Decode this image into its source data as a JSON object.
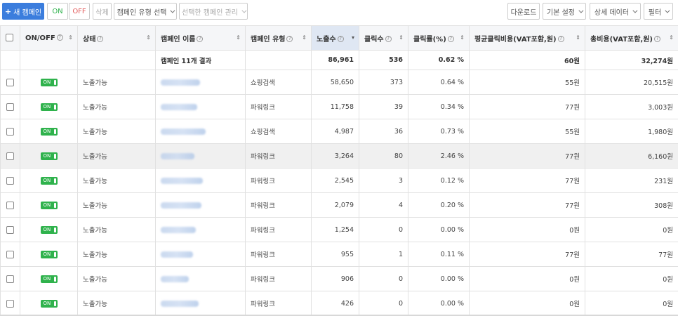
{
  "toolbar": {
    "new_campaign": "새 캠페인",
    "on": "ON",
    "off": "OFF",
    "delete": "삭제",
    "campaign_type_select": "캠페인 유형 선택",
    "manage_selected": "선택한 캠페인 관리",
    "download": "다운로드",
    "basic_settings": "기본 설정",
    "detail_data": "상세 데이터",
    "filter": "필터"
  },
  "table": {
    "headers": {
      "onoff": "ON/OFF",
      "status": "상태",
      "name": "캠페인 이름",
      "type": "캠페인 유형",
      "impressions": "노출수",
      "clicks": "클릭수",
      "ctr": "클릭률(%)",
      "avg_cpc": "평균클릭비용(VAT포함,원)",
      "total_cost": "총비용(VAT포함,원)"
    },
    "help_glyph": "?",
    "sort_glyph": "⇕",
    "sort_active_glyph": "▾",
    "summary": {
      "label": "캠페인 11개 결과",
      "impressions": "86,961",
      "clicks": "536",
      "ctr": "0.62 %",
      "avg_cpc": "60원",
      "total_cost": "32,274원"
    },
    "toggle_label": "ON",
    "rows": [
      {
        "status": "노출가능",
        "type": "쇼핑검색",
        "impressions": "58,650",
        "clicks": "373",
        "ctr": "0.64 %",
        "avg_cpc": "55원",
        "total_cost": "20,515원"
      },
      {
        "status": "노출가능",
        "type": "파워링크",
        "impressions": "11,758",
        "clicks": "39",
        "ctr": "0.34 %",
        "avg_cpc": "77원",
        "total_cost": "3,003원"
      },
      {
        "status": "노출가능",
        "type": "쇼핑검색",
        "impressions": "4,987",
        "clicks": "36",
        "ctr": "0.73 %",
        "avg_cpc": "55원",
        "total_cost": "1,980원"
      },
      {
        "status": "노출가능",
        "type": "파워링크",
        "impressions": "3,264",
        "clicks": "80",
        "ctr": "2.46 %",
        "avg_cpc": "77원",
        "total_cost": "6,160원"
      },
      {
        "status": "노출가능",
        "type": "파워링크",
        "impressions": "2,545",
        "clicks": "3",
        "ctr": "0.12 %",
        "avg_cpc": "77원",
        "total_cost": "231원"
      },
      {
        "status": "노출가능",
        "type": "파워링크",
        "impressions": "2,079",
        "clicks": "4",
        "ctr": "0.20 %",
        "avg_cpc": "77원",
        "total_cost": "308원"
      },
      {
        "status": "노출가능",
        "type": "파워링크",
        "impressions": "1,254",
        "clicks": "0",
        "ctr": "0.00 %",
        "avg_cpc": "0원",
        "total_cost": "0원"
      },
      {
        "status": "노출가능",
        "type": "파워링크",
        "impressions": "955",
        "clicks": "1",
        "ctr": "0.11 %",
        "avg_cpc": "77원",
        "total_cost": "77원"
      },
      {
        "status": "노출가능",
        "type": "파워링크",
        "impressions": "906",
        "clicks": "0",
        "ctr": "0.00 %",
        "avg_cpc": "0원",
        "total_cost": "0원"
      },
      {
        "status": "노출가능",
        "type": "파워링크",
        "impressions": "426",
        "clicks": "0",
        "ctr": "0.00 %",
        "avg_cpc": "0원",
        "total_cost": "0원"
      }
    ]
  },
  "colors": {
    "primary": "#3b7ddd",
    "on_green": "#2fb24c",
    "off_red": "#e25d5d",
    "sorted_header": "#dfe7f3"
  }
}
